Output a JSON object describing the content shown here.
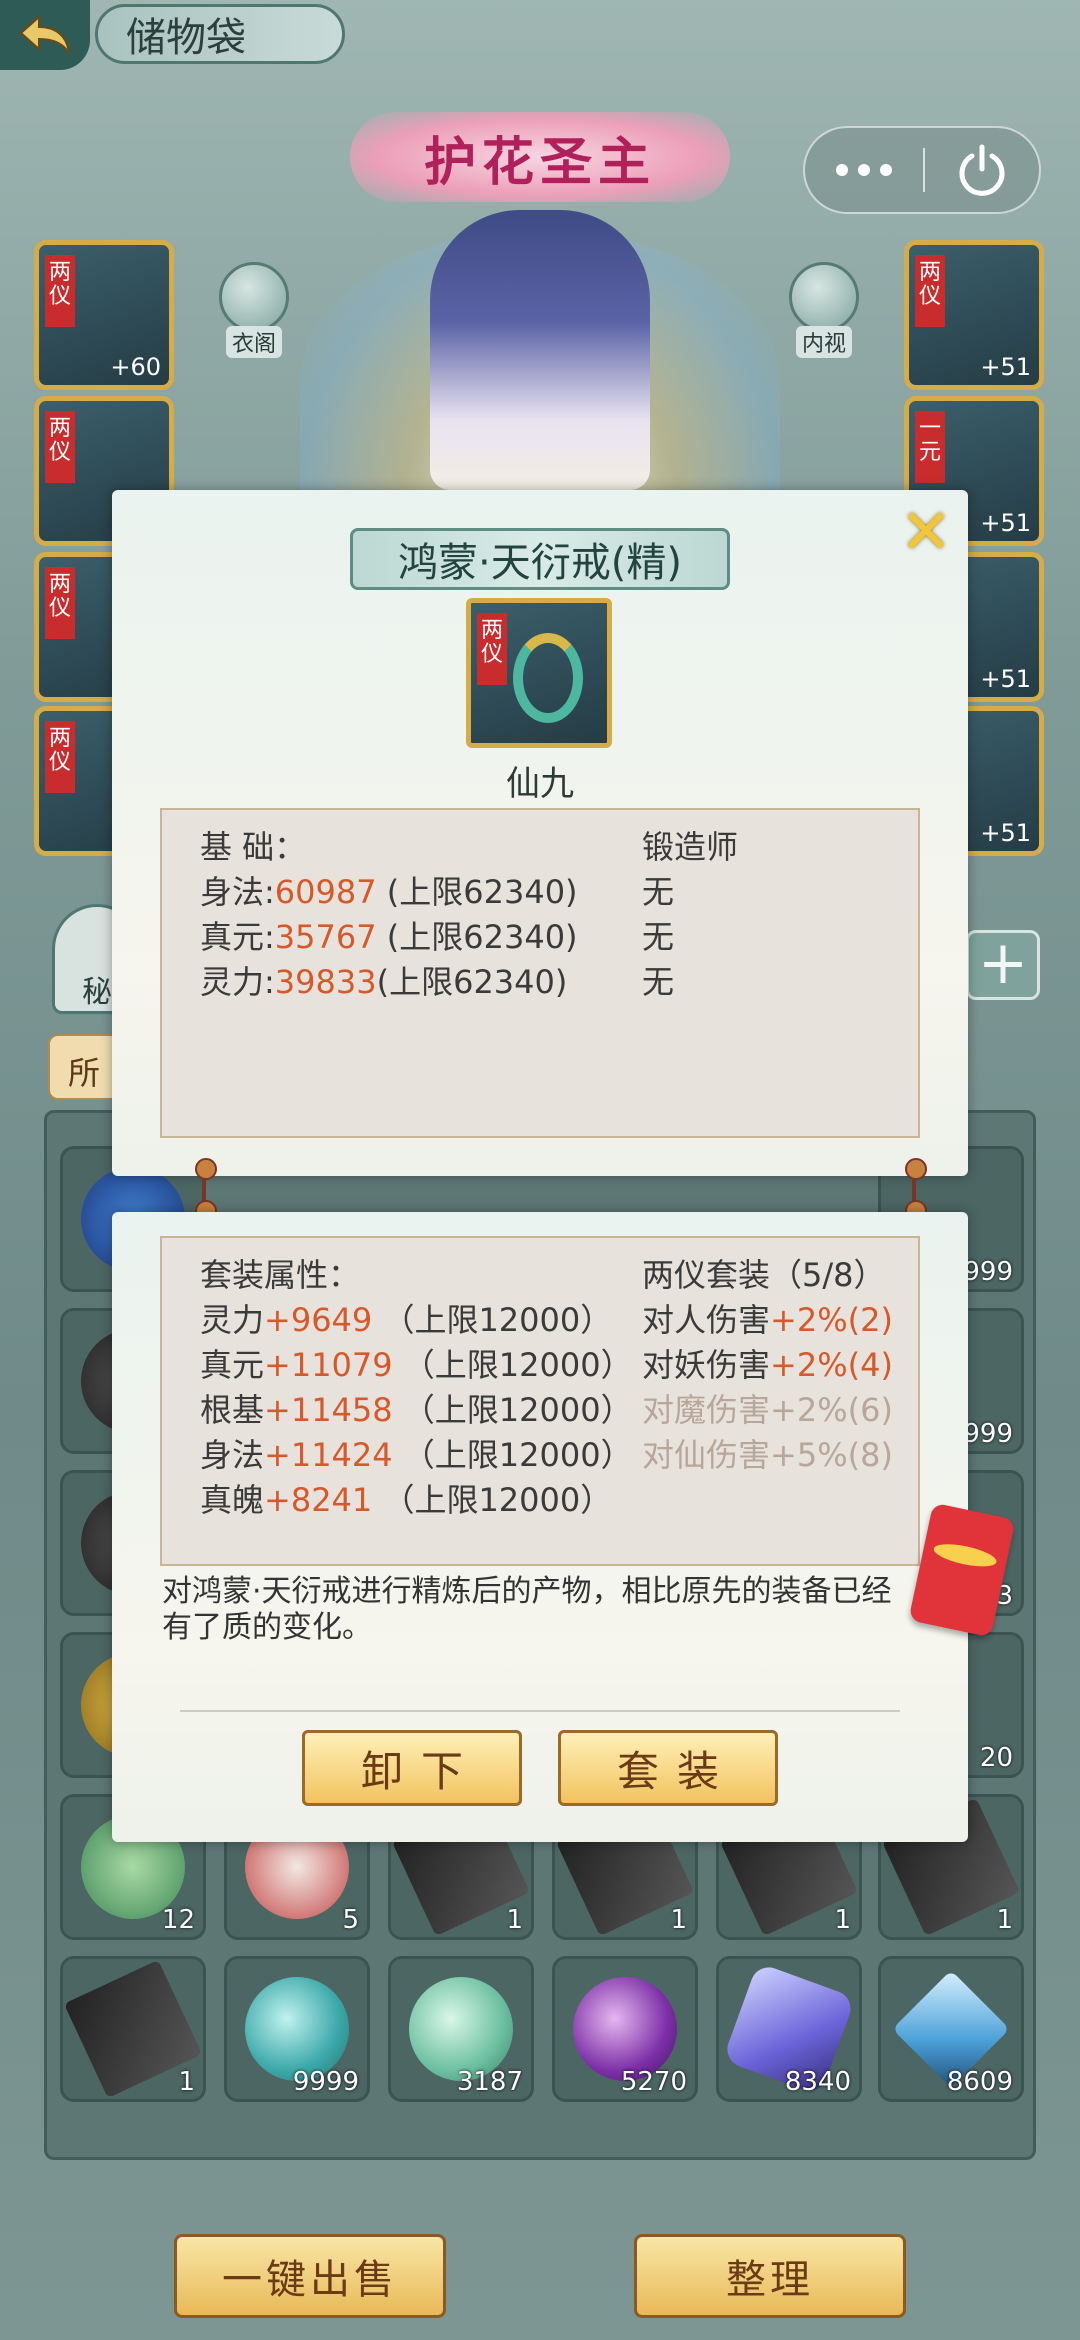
{
  "header": {
    "title": "储物袋"
  },
  "capsule": {
    "more_icon": "more-dots-icon",
    "power_icon": "power-icon"
  },
  "character": {
    "banner": "护花圣主",
    "left_button": "衣阁",
    "right_button": "内视"
  },
  "equipment": {
    "left": [
      {
        "tag": "两仪",
        "level": "+60"
      },
      {
        "tag": "两仪",
        "level": ""
      },
      {
        "tag": "两仪",
        "level": ""
      },
      {
        "tag": "两仪",
        "level": ""
      }
    ],
    "right": [
      {
        "tag": "两仪",
        "level": "+51"
      },
      {
        "tag": "一元",
        "level": "+51"
      },
      {
        "tag": "",
        "level": "+51"
      },
      {
        "tag": "",
        "level": "+51"
      }
    ]
  },
  "bag": {
    "side_tab_1": "秘",
    "side_tab_2": "所",
    "rows": [
      [
        "",
        "",
        "",
        "",
        "",
        "999"
      ],
      [
        "",
        "",
        "",
        "",
        "",
        "999"
      ],
      [
        "",
        "",
        "",
        "",
        "",
        "3"
      ],
      [
        "",
        "",
        "",
        "",
        "",
        "20"
      ],
      [
        "12",
        "5",
        "1",
        "1",
        "1",
        "1"
      ],
      [
        "1",
        "9999",
        "3187",
        "5270",
        "8340",
        "8609"
      ]
    ],
    "sell_all": "一键出售",
    "arrange": "整理"
  },
  "popup": {
    "name": "鸿蒙·天衍戒(精)",
    "icon_tag": "两仪",
    "quality": "仙九",
    "base": {
      "header": "基 础：",
      "forger_header": "锻造师",
      "stats": [
        {
          "label": "身法:",
          "value": "60987",
          "cap": " (上限62340)",
          "forger": "无"
        },
        {
          "label": "真元:",
          "value": "35767",
          "cap": " (上限62340)",
          "forger": "无"
        },
        {
          "label": "灵力:",
          "value": "39833",
          "cap": "(上限62340)",
          "forger": "无"
        }
      ]
    },
    "set": {
      "header": "套装属性：",
      "set_name": "两仪套装（5/8）",
      "stats": [
        {
          "label": "灵力",
          "value": "+9649",
          "cap": " （上限12000）"
        },
        {
          "label": "真元",
          "value": "+11079",
          "cap": " （上限12000）"
        },
        {
          "label": "根基",
          "value": "+11458",
          "cap": " （上限12000）"
        },
        {
          "label": "身法",
          "value": "+11424",
          "cap": " （上限12000）"
        },
        {
          "label": "真魄",
          "value": "+8241",
          "cap": " （上限12000）"
        }
      ],
      "bonuses": [
        {
          "label": "对人伤害",
          "value": "+2%(2)",
          "active": true
        },
        {
          "label": "对妖伤害",
          "value": "+2%(4)",
          "active": true
        },
        {
          "label": "对魔伤害",
          "value": "+2%(6)",
          "active": false
        },
        {
          "label": "对仙伤害",
          "value": "+5%(8)",
          "active": false
        }
      ]
    },
    "description": "对鸿蒙·天衍戒进行精炼后的产物，相比原先的装备已经有了质的变化。",
    "unequip": "卸下",
    "set_button": "套装"
  },
  "colors": {
    "accent": "#d5592a",
    "gold_border": "#d6ac48",
    "inactive": "#b8a69a"
  }
}
